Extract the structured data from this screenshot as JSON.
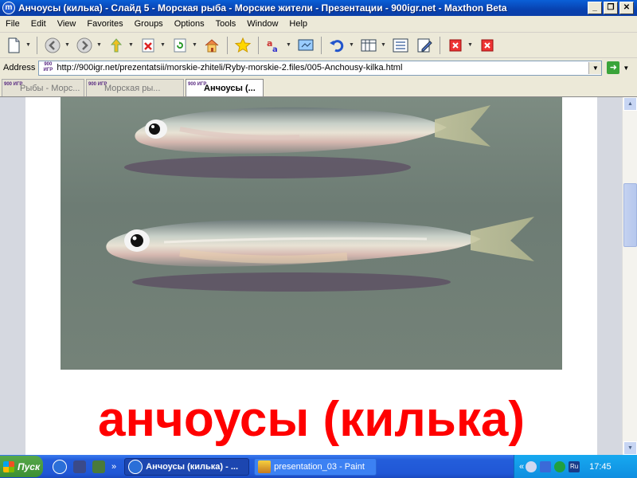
{
  "window": {
    "title": "Анчоусы (килька) - Слайд 5 - Морская рыба - Морские жители - Презентации - 900igr.net - Maxthon Beta",
    "app_icon_letter": "m",
    "buttons": {
      "minimize": "_",
      "maximize": "❐",
      "close": "✕"
    }
  },
  "menu": {
    "items": [
      {
        "id": "file",
        "label": "File"
      },
      {
        "id": "edit",
        "label": "Edit"
      },
      {
        "id": "view",
        "label": "View"
      },
      {
        "id": "favorites",
        "label": "Favorites"
      },
      {
        "id": "groups",
        "label": "Groups"
      },
      {
        "id": "options",
        "label": "Options"
      },
      {
        "id": "tools",
        "label": "Tools"
      },
      {
        "id": "window",
        "label": "Window"
      },
      {
        "id": "help",
        "label": "Help"
      }
    ]
  },
  "toolbar": {
    "icons": [
      "new-page-icon",
      "back-icon",
      "forward-icon",
      "up-icon",
      "stop-icon",
      "refresh-icon",
      "home-icon",
      "favorites-star-icon",
      "translate-icon",
      "screen-icon",
      "undo-icon",
      "columns-icon",
      "list-icon",
      "edit-icon",
      "close-tab-icon",
      "close-all-icon"
    ]
  },
  "address": {
    "label": "Address",
    "site_icon_text": "900 ИГР",
    "url": "http://900igr.net/prezentatsii/morskie-zhiteli/Ryby-morskie-2.files/005-Anchousy-kilka.html"
  },
  "tabs": [
    {
      "label": "Рыбы - Морс...",
      "site_icon_text": "900 ИГР",
      "active": false
    },
    {
      "label": "Морская ры...",
      "site_icon_text": "900 ИГР",
      "active": false
    },
    {
      "label": "Анчоусы (...",
      "site_icon_text": "900 ИГР",
      "active": true
    }
  ],
  "content": {
    "caption": "анчоусы (килька)",
    "photo_alt": "two anchovy fish on gray background"
  },
  "taskbar": {
    "start_label": "Пуск",
    "quick_more": "»",
    "tasks": [
      {
        "label": "Анчоусы (килька) - ...",
        "active": true
      },
      {
        "label": "presentation_03 - Paint",
        "active": false
      }
    ],
    "tray": {
      "lang": "RL",
      "lang2": "Ru",
      "collapse": "«",
      "time": "17:45"
    }
  },
  "colors": {
    "caption": "#ff0000",
    "titlebar": "#0842b0",
    "taskbar": "#245edb"
  }
}
